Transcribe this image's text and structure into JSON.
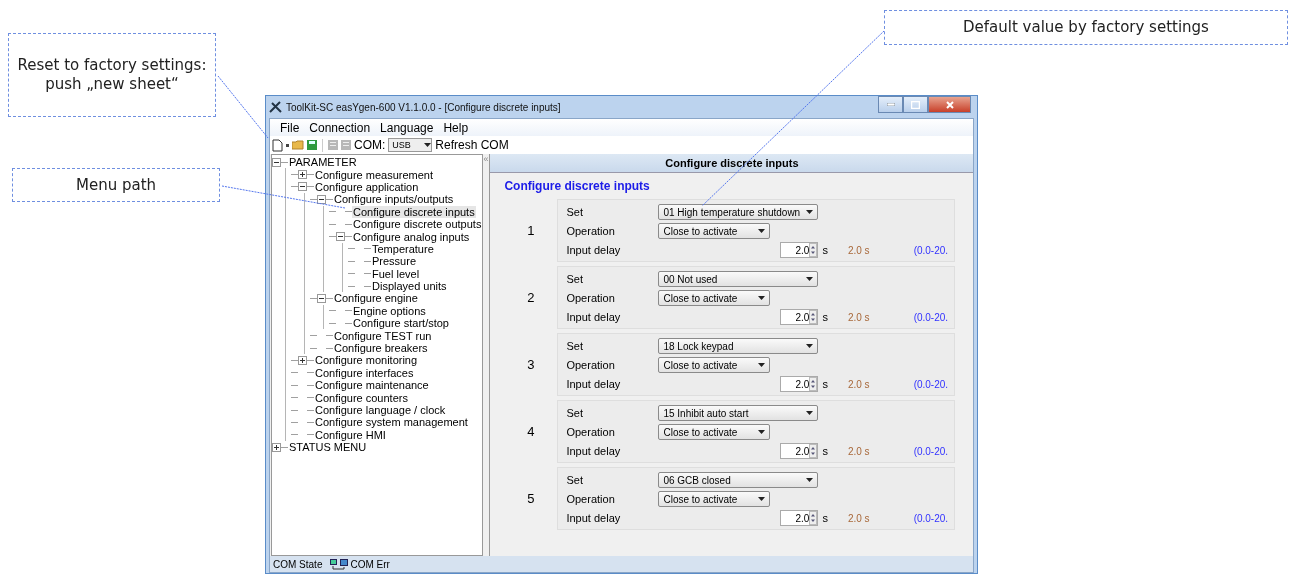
{
  "annotations": [
    {
      "kind": "reset",
      "text": "Reset to factory settings: push „new sheet“"
    },
    {
      "kind": "menu",
      "text": "Menu path"
    },
    {
      "kind": "default",
      "text": "Default value by factory settings"
    }
  ],
  "window": {
    "title": "ToolKit-SC easYgen-600  V1.1.0.0 - [Configure discrete inputs]"
  },
  "menu": [
    "File",
    "Connection",
    "Language",
    "Help"
  ],
  "toolbar": {
    "com_label": "COM:",
    "com_value": "USB",
    "refresh": "Refresh COM"
  },
  "tree": [
    {
      "label": "PARAMETER",
      "expanded": true,
      "selected": false,
      "children": [
        {
          "label": "Configure measurement",
          "expanded": false,
          "selected": false
        },
        {
          "label": "Configure application",
          "expanded": true,
          "selected": false,
          "children": [
            {
              "label": "Configure inputs/outputs",
              "expanded": true,
              "selected": false,
              "children": [
                {
                  "label": "Configure discrete inputs",
                  "selected": true
                },
                {
                  "label": "Configure discrete outputs",
                  "selected": false
                },
                {
                  "label": "Configure analog inputs",
                  "expanded": true,
                  "selected": false,
                  "children": [
                    {
                      "label": "Temperature",
                      "selected": false
                    },
                    {
                      "label": "Pressure",
                      "selected": false
                    },
                    {
                      "label": "Fuel level",
                      "selected": false
                    },
                    {
                      "label": "Displayed units",
                      "selected": false
                    }
                  ]
                }
              ]
            },
            {
              "label": "Configure engine",
              "expanded": true,
              "selected": false,
              "children": [
                {
                  "label": "Engine options",
                  "selected": false
                },
                {
                  "label": "Configure start/stop",
                  "selected": false
                }
              ]
            },
            {
              "label": "Configure TEST run",
              "selected": false
            },
            {
              "label": "Configure breakers",
              "selected": false
            }
          ]
        },
        {
          "label": "Configure monitoring",
          "expanded": false,
          "selected": false
        },
        {
          "label": "Configure interfaces",
          "selected": false
        },
        {
          "label": "Configure maintenance",
          "selected": false
        },
        {
          "label": "Configure counters",
          "selected": false
        },
        {
          "label": "Configure language / clock",
          "selected": false
        },
        {
          "label": "Configure system management",
          "selected": false
        },
        {
          "label": "Configure HMI",
          "selected": false
        }
      ]
    },
    {
      "label": "STATUS MENU",
      "expanded": false,
      "selected": false
    }
  ],
  "collapse_glyph": "«",
  "panel": {
    "header": "Configure discrete inputs",
    "heading": "Configure discrete inputs",
    "inputs": [
      {
        "number": "1",
        "set_label": "Set",
        "set": "01 High temperature shutdown",
        "operation_label": "Operation",
        "operation": "Close to activate",
        "delay_label": "Input delay",
        "delay": "2.0",
        "unit": "s",
        "default": "2.0 s",
        "range": "(0.0-20."
      },
      {
        "number": "2",
        "set_label": "Set",
        "set": "00 Not used",
        "operation_label": "Operation",
        "operation": "Close to activate",
        "delay_label": "Input delay",
        "delay": "2.0",
        "unit": "s",
        "default": "2.0 s",
        "range": "(0.0-20."
      },
      {
        "number": "3",
        "set_label": "Set",
        "set": "18 Lock keypad",
        "operation_label": "Operation",
        "operation": "Close to activate",
        "delay_label": "Input delay",
        "delay": "2.0",
        "unit": "s",
        "default": "2.0 s",
        "range": "(0.0-20."
      },
      {
        "number": "4",
        "set_label": "Set",
        "set": "15 Inhibit auto start",
        "operation_label": "Operation",
        "operation": "Close to activate",
        "delay_label": "Input delay",
        "delay": "2.0",
        "unit": "s",
        "default": "2.0 s",
        "range": "(0.0-20."
      },
      {
        "number": "5",
        "set_label": "Set",
        "set": "06 GCB closed",
        "operation_label": "Operation",
        "operation": "Close to activate",
        "delay_label": "Input delay",
        "delay": "2.0",
        "unit": "s",
        "default": "2.0 s",
        "range": "(0.0-20."
      }
    ]
  },
  "status_bar": {
    "state": "COM State",
    "error": "COM Err"
  }
}
